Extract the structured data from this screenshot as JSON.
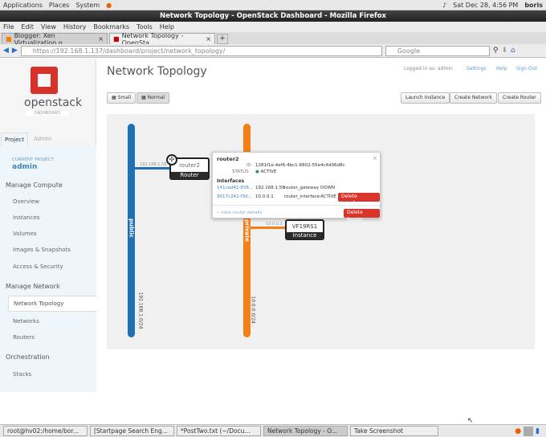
{
  "gnome": {
    "menus": [
      "Applications",
      "Places",
      "System"
    ],
    "clock": "Sat Dec 28,  4:56 PM",
    "user": "boris"
  },
  "window_title": "Network Topology - OpenStack Dashboard - Mozilla Firefox",
  "menu": [
    "File",
    "Edit",
    "View",
    "History",
    "Bookmarks",
    "Tools",
    "Help"
  ],
  "tabs": [
    {
      "label": "Blogger: Xen Virtualization o..."
    },
    {
      "label": "Network Topology - OpenSta..."
    }
  ],
  "url": "https://192.168.1.137/dashboard/project/network_topology/",
  "search_placeholder": "Google",
  "brand": {
    "logo_text": "openstack",
    "sub": "DASHBOARD"
  },
  "sidebar": {
    "tabs": [
      "Project",
      "Admin"
    ],
    "current_label": "CURRENT PROJECT",
    "current": "admin",
    "compute_header": "Manage Compute",
    "compute": [
      "Overview",
      "Instances",
      "Volumes",
      "Images & Snapshots",
      "Access & Security"
    ],
    "network_header": "Manage Network",
    "network": [
      "Network Topology",
      "Networks",
      "Routers"
    ],
    "orch_header": "Orchestration",
    "orch": [
      "Stacks"
    ]
  },
  "header": {
    "title": "Network Topology",
    "logged_in": "Logged in as: admin",
    "settings": "Settings",
    "help": "Help",
    "sign_out": "Sign Out"
  },
  "toolbar": {
    "small": "Small",
    "normal": "Normal",
    "launch": "Launch Instance",
    "create_network": "Create Network",
    "create_router": "Create Router"
  },
  "topology": {
    "networks": [
      {
        "name": "public",
        "cidr": "192.168.1.0/24",
        "color": "#1f6fb5"
      },
      {
        "name": "private",
        "cidr": "10.0.0.0/24",
        "color": "#f57f17"
      }
    ],
    "router": {
      "name": "router2",
      "type": "Router",
      "port_ip": "192.168.1.58"
    },
    "instance": {
      "name": "VF19RS1",
      "type": "Instance",
      "port_ip": "10.0.0.3"
    }
  },
  "popup": {
    "title": "router2",
    "id_label": "ID",
    "id": "1281f1e-4ef6-4bc1-8802-55e4c4d06d8c",
    "status_label": "STATUS",
    "status": "ACTIVE",
    "interfaces_label": "Interfaces",
    "interfaces": [
      {
        "id": "141cad42-838...",
        "ip": "192.168.1.58",
        "type": "router_gateway",
        "status": "DOWN"
      },
      {
        "id": "9017c241-f3d...",
        "ip": "10.0.0.1",
        "type": "router_interface",
        "status": "ACTIVE",
        "action": "Delete Interface"
      }
    ],
    "view_details": "» view router details",
    "delete": "Delete Router",
    "close": "×"
  },
  "taskbar": [
    "root@hv02:/home/bor...",
    "[Startpage Search Eng...",
    "*PostTwo.txt (~/Docu...",
    "Network Topology - O...",
    "Take Screenshot"
  ]
}
